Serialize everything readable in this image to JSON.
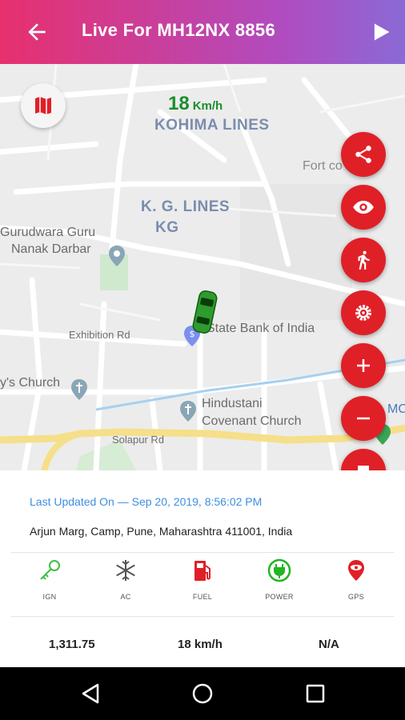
{
  "header": {
    "title": "Live For MH12NX 8856",
    "back_icon": "arrow-left-icon",
    "play_icon": "play-icon",
    "gradient_start": "#e7306e",
    "gradient_end": "#8a6ad6"
  },
  "map": {
    "speed_value": "18",
    "speed_unit": "Km/h",
    "labels": {
      "kohima": "KOHIMA LINES",
      "fort": "Fort co",
      "kg_lines": "K. G. LINES",
      "kg": "KG",
      "gurudwara_1": "Gurudwara Guru",
      "gurudwara_2": "Nanak Darbar",
      "exhibition": "Exhibition Rd",
      "sbi": "State Bank of India",
      "church": "y's Church",
      "hindustani_1": "Hindustani",
      "hindustani_2": "Covenant Church",
      "solapur": "Solapur Rd",
      "mc": "MC"
    },
    "vehicle_color": "#2e9b2e",
    "fab_color": "#e02027",
    "fab_buttons": [
      "share-icon",
      "eye-icon",
      "walk-icon",
      "settings-icon",
      "plus-icon",
      "minus-icon",
      "stop-icon"
    ]
  },
  "details": {
    "last_updated": "Last Updated On — Sep 20, 2019, 8:56:02 PM",
    "address": "Arjun Marg, Camp, Pune, Maharashtra 411001, India",
    "status": [
      {
        "label": "IGN",
        "icon": "key-icon",
        "color": "#3fbf3f"
      },
      {
        "label": "AC",
        "icon": "snowflake-icon",
        "color": "#555555"
      },
      {
        "label": "FUEL",
        "icon": "fuel-pump-icon",
        "color": "#e02027"
      },
      {
        "label": "POWER",
        "icon": "power-plug-icon",
        "color": "#22b522"
      },
      {
        "label": "GPS",
        "icon": "gps-pin-icon",
        "color": "#e02027"
      }
    ],
    "stats": {
      "odometer": "1,311.75",
      "speed": "18 km/h",
      "other": "N/A"
    }
  },
  "navbar": {
    "back": "nav-back-icon",
    "home": "nav-home-icon",
    "recents": "nav-recents-icon"
  }
}
